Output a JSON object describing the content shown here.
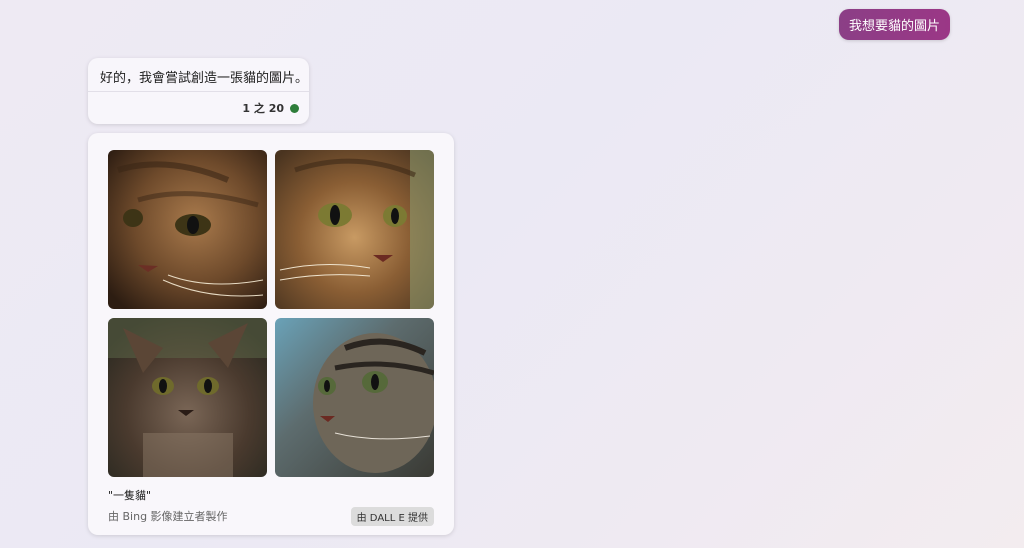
{
  "user_message": "我想要貓的圖片",
  "bot": {
    "message": "好的，我會嘗試創造一張貓的圖片。",
    "counter": "1 之 20",
    "status_color": "#2e7d3a"
  },
  "image_card": {
    "images": [
      {
        "alt": "tabby cat close-up"
      },
      {
        "alt": "tabby cat face"
      },
      {
        "alt": "fluffy tabby cat"
      },
      {
        "alt": "tabby cat profile"
      }
    ],
    "caption": "\"一隻貓\"",
    "creator": "由 Bing 影像建立者製作",
    "badge": "由 DALL E 提供"
  }
}
